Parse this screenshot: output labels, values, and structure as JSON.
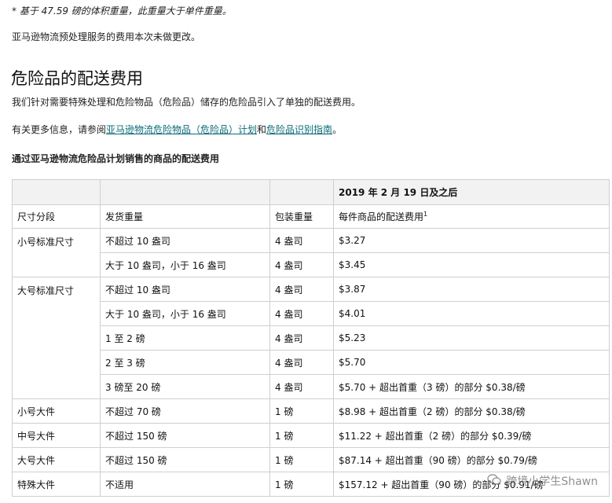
{
  "note": "* 基于 47.59 磅的体积重量，此重量大于单件重量。",
  "p1": "亚马逊物流预处理服务的费用本次未做更改。",
  "heading": "危险品的配送费用",
  "p2": "我们针对需要特殊处理和危险物品（危险品）储存的危险品引入了单独的配送费用。",
  "p3": {
    "before": "有关更多信息，请参阅",
    "link1": "亚马逊物流危险物品（危险品）计划",
    "mid": "和",
    "link2": "危险品识别指南",
    "after": "。"
  },
  "p4": "通过亚马逊物流危险品计划销售的商品的配送费用",
  "table": {
    "date_header": "2019 年 2 月 19 日及之后",
    "col1": "尺寸分段",
    "col2": "发货重量",
    "col3": "包装重量",
    "col4": "每件商品的配送费用",
    "col4_sup": "1",
    "rows": [
      {
        "tier": "小号标准尺寸",
        "weight": "不超过 10 盎司",
        "pack": "4 盎司",
        "fee": "$3.27"
      },
      {
        "tier": "",
        "weight": "大于 10 盎司，小于 16 盎司",
        "pack": "4 盎司",
        "fee": "$3.45"
      },
      {
        "tier": "大号标准尺寸",
        "weight": "不超过 10 盎司",
        "pack": "4 盎司",
        "fee": "$3.87"
      },
      {
        "tier": "",
        "weight": "大于 10 盎司，小于 16 盎司",
        "pack": "4 盎司",
        "fee": "$4.01"
      },
      {
        "tier": "",
        "weight": "1 至 2 磅",
        "pack": "4 盎司",
        "fee": "$5.23"
      },
      {
        "tier": "",
        "weight": "2 至 3 磅",
        "pack": "4 盎司",
        "fee": "$5.70"
      },
      {
        "tier": "",
        "weight": "3 磅至 20 磅",
        "pack": "4 盎司",
        "fee": "$5.70 + 超出首重（3 磅）的部分 $0.38/磅"
      },
      {
        "tier": "小号大件",
        "weight": "不超过 70 磅",
        "pack": "1 磅",
        "fee": "$8.98 + 超出首重（2 磅）的部分 $0.38/磅"
      },
      {
        "tier": "中号大件",
        "weight": "不超过 150 磅",
        "pack": "1 磅",
        "fee": "$11.22 + 超出首重（2 磅）的部分 $0.39/磅"
      },
      {
        "tier": "大号大件",
        "weight": "不超过 150 磅",
        "pack": "1 磅",
        "fee": "$87.14 + 超出首重（90 磅）的部分 $0.79/磅"
      },
      {
        "tier": "特殊大件",
        "weight": "不适用",
        "pack": "1 磅",
        "fee": "$157.12 + 超出首重（90 磅）的部分 $0.91/磅"
      }
    ]
  },
  "watermark": "跨境小学生Shawn"
}
